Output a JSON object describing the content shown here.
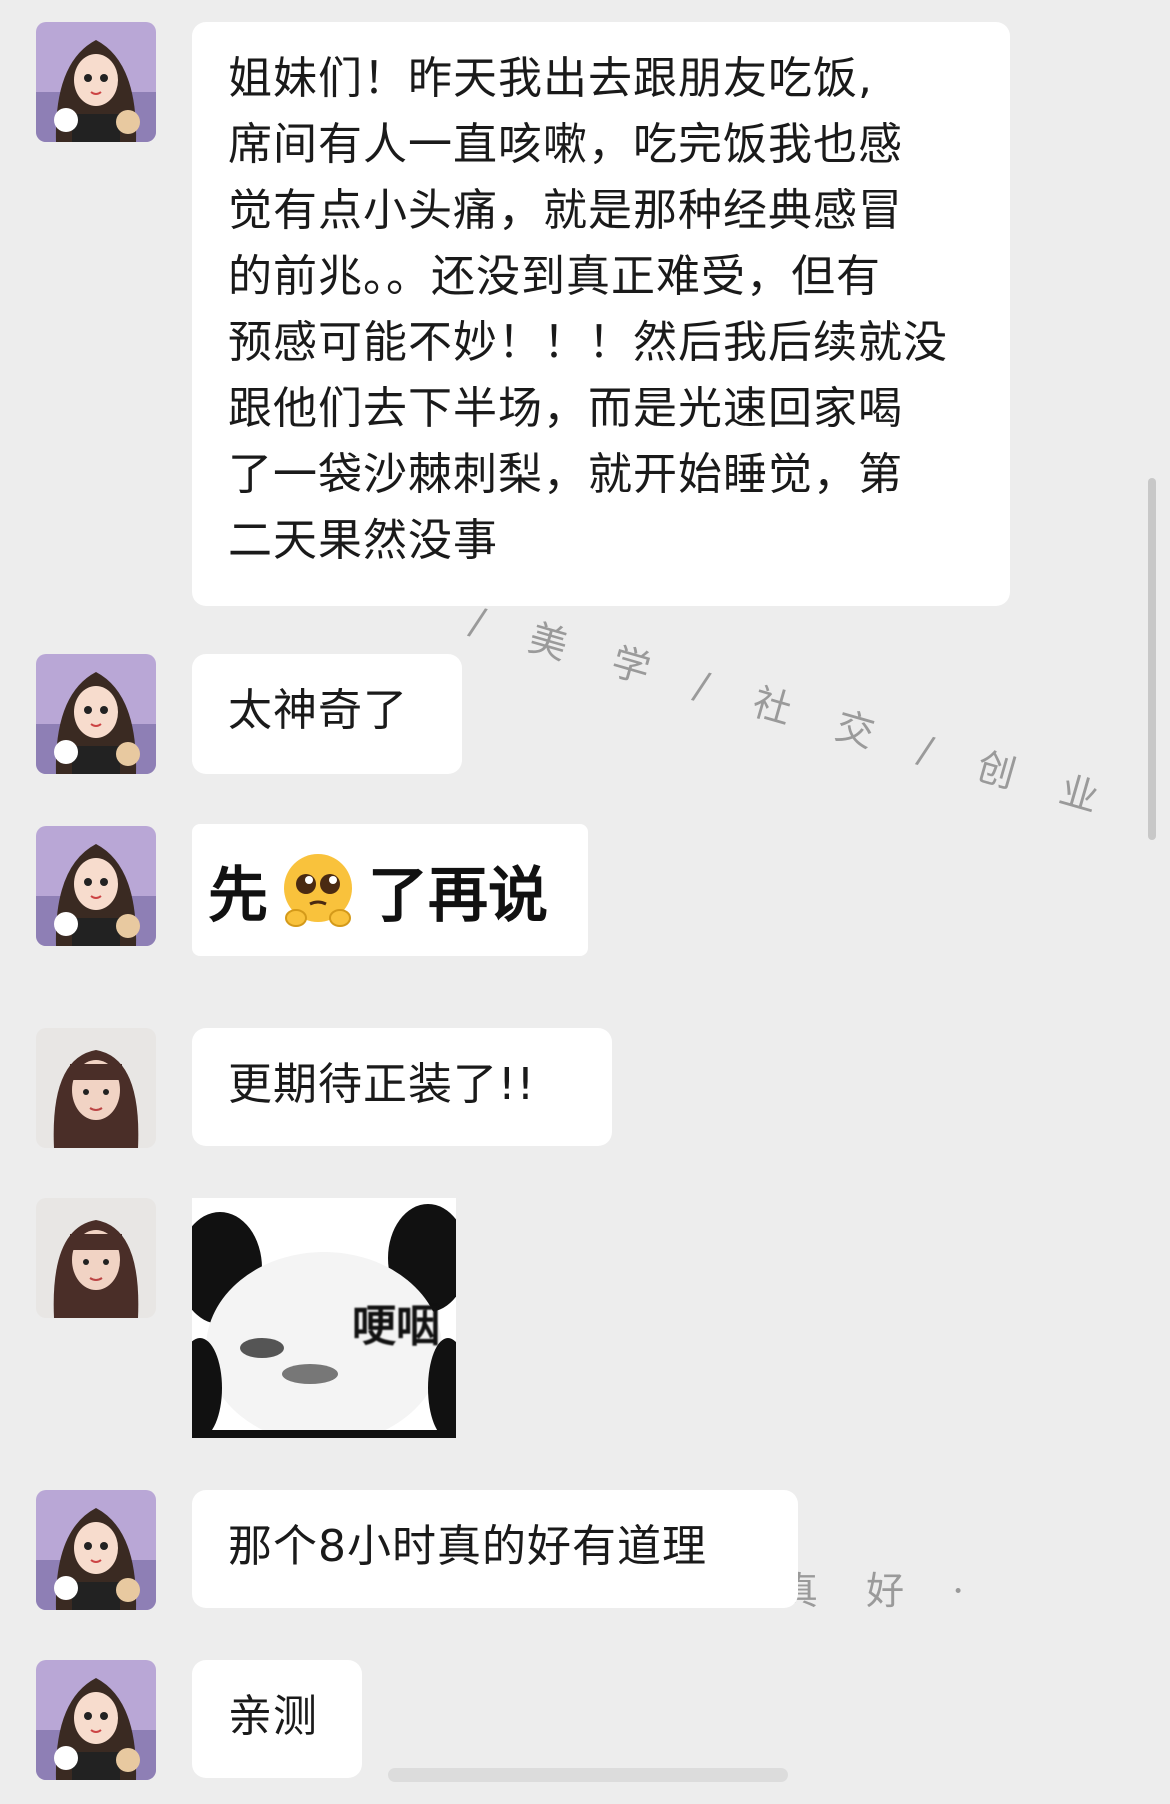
{
  "messages": [
    {
      "lines": [
        "姐妹们！昨天我出去跟朋友吃饭,",
        "席间有人一直咳嗽，吃完饭我也感",
        "觉有点小头痛，就是那种经典感冒",
        "的前兆。。还没到真正难受，但有",
        "预感可能不妙！！！然后我后续就没",
        "跟他们去下半场，而是光速回家喝",
        "了一袋沙棘刺梨，就开始睡觉，第",
        "二天果然没事"
      ]
    },
    {
      "text": "太神奇了"
    },
    {
      "text_before": "先",
      "text_after": "了再说",
      "emoji": "pleading-face-emoji"
    },
    {
      "text": "更期待正装了!!"
    },
    {
      "sticker_caption": "哽咽"
    },
    {
      "text": "那个8小时真的好有道理"
    },
    {
      "text": "亲测"
    }
  ],
  "watermark": {
    "line1": "/ 美 学 / 社 交 / 创 业",
    "line2": "真 好 ·"
  },
  "colors": {
    "background": "#ededed",
    "bubble": "#ffffff",
    "text": "#1a1a1a"
  }
}
